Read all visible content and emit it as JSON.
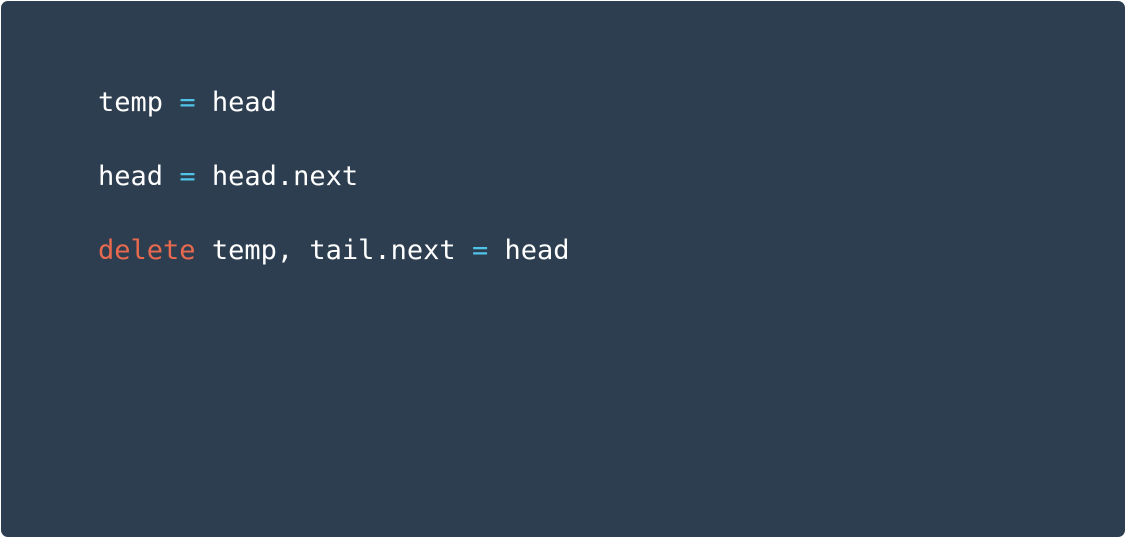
{
  "colors": {
    "background": "#2d3e50",
    "text": "#ffffff",
    "keyword": "#e9694f",
    "operator": "#4fc3e8"
  },
  "code": {
    "lines": [
      {
        "tokens": [
          {
            "type": "id",
            "text": "temp"
          },
          {
            "type": "pn",
            "text": " "
          },
          {
            "type": "op",
            "text": "="
          },
          {
            "type": "pn",
            "text": " "
          },
          {
            "type": "id",
            "text": "head"
          }
        ]
      },
      {
        "tokens": [
          {
            "type": "id",
            "text": "head"
          },
          {
            "type": "pn",
            "text": " "
          },
          {
            "type": "op",
            "text": "="
          },
          {
            "type": "pn",
            "text": " "
          },
          {
            "type": "id",
            "text": "head.next"
          }
        ]
      },
      {
        "tokens": [
          {
            "type": "kw",
            "text": "delete"
          },
          {
            "type": "pn",
            "text": " "
          },
          {
            "type": "id",
            "text": "temp"
          },
          {
            "type": "pn",
            "text": ", "
          },
          {
            "type": "id",
            "text": "tail.next"
          },
          {
            "type": "pn",
            "text": " "
          },
          {
            "type": "op",
            "text": "="
          },
          {
            "type": "pn",
            "text": " "
          },
          {
            "type": "id",
            "text": "head"
          }
        ]
      }
    ]
  }
}
